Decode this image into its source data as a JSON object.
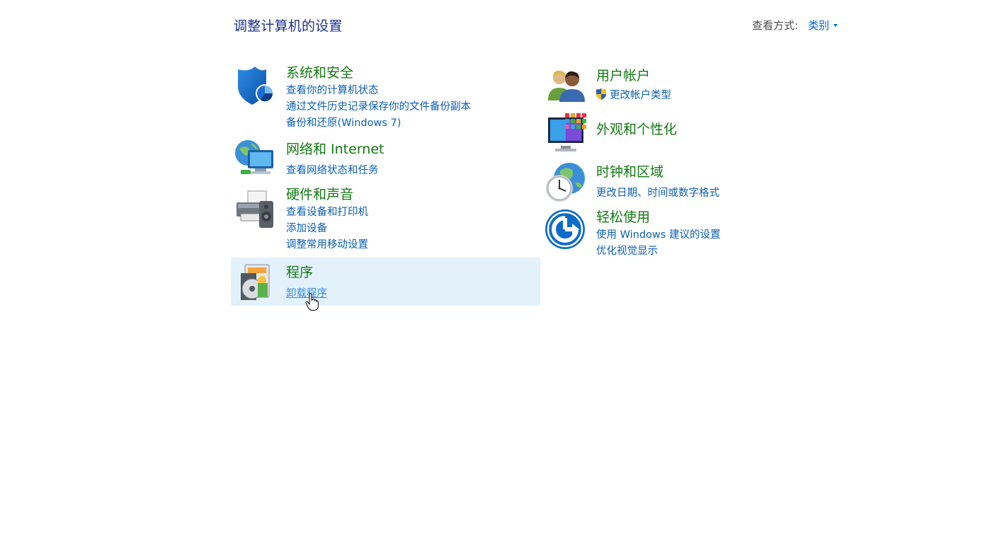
{
  "header": {
    "title": "调整计算机的设置",
    "view_by_label": "查看方式:",
    "view_by_value": "类别"
  },
  "categories": {
    "system_security": {
      "title": "系统和安全",
      "links": [
        "查看你的计算机状态",
        "通过文件历史记录保存你的文件备份副本",
        "备份和还原(Windows 7)"
      ],
      "icon": "shield-icon"
    },
    "network": {
      "title": "网络和 Internet",
      "links": [
        "查看网络状态和任务"
      ],
      "icon": "network-globe-icon"
    },
    "hardware_sound": {
      "title": "硬件和声音",
      "links": [
        "查看设备和打印机",
        "添加设备",
        "调整常用移动设置"
      ],
      "icon": "printer-icon"
    },
    "programs": {
      "title": "程序",
      "links": [
        "卸载程序"
      ],
      "icon": "programs-disc-icon"
    },
    "user_accounts": {
      "title": "用户帐户",
      "links": [
        "更改帐户类型"
      ],
      "icon": "users-icon"
    },
    "appearance": {
      "title": "外观和个性化",
      "links": [],
      "icon": "monitor-colors-icon"
    },
    "clock_region": {
      "title": "时钟和区域",
      "links": [
        "更改日期、时间或数字格式"
      ],
      "icon": "clock-globe-icon"
    },
    "ease_access": {
      "title": "轻松使用",
      "links": [
        "使用 Windows 建议的设置",
        "优化视觉显示"
      ],
      "icon": "ease-of-access-icon"
    }
  },
  "colors": {
    "title_blue": "#1e3287",
    "category_green": "#127a12",
    "link_blue": "#0b5fb0",
    "hover_bg": "#e3f1fb"
  }
}
